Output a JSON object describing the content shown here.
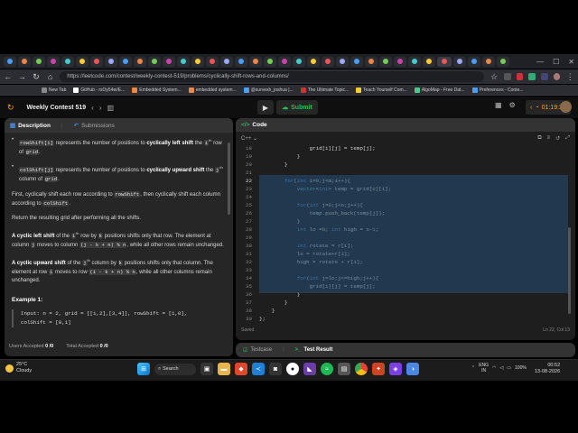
{
  "browser": {
    "url": "https://leetcode.com/contest/weekly-contest-519/problems/cyclically-shift-rows-and-columns/",
    "bookmarks": [
      "New Tab",
      "GitHub - rsOy54ei/E...",
      "Embedded System...",
      "embedded system...",
      "@survesh_joshua |...",
      "The Ultimate Topic...",
      "Teach Yourself Com...",
      "AlgoMap - Free Dat...",
      "Preferences - Conte..."
    ],
    "tab_letters": [
      "D",
      "N",
      "F",
      "A",
      "F",
      "D",
      "C",
      "E",
      "F",
      "X",
      "F",
      "C",
      "F",
      "F",
      "B",
      "S",
      "D",
      "C",
      "C",
      "C",
      "A",
      "A",
      "T",
      "F",
      "F",
      "F",
      "F",
      "F",
      "M",
      "F",
      "E",
      "C",
      "F",
      "F",
      "V"
    ]
  },
  "header": {
    "contest_title": "Weekly Contest 519",
    "submit_label": "Submit",
    "timer": "01:19:29"
  },
  "description": {
    "tabs": {
      "description": "Description",
      "submissions": "Submissions"
    },
    "bullet1": {
      "code": "rowShift[i]",
      "t1": " represents the number of positions to ",
      "bold": "cyclically left shift",
      "t2": " the ",
      "ith": "i",
      "sup": "th",
      "t3": " row of ",
      "code2": "grid",
      "t4": "."
    },
    "bullet2": {
      "code": "colShift[j]",
      "t1": " represents the number of positions to ",
      "bold": "cyclically upward shift",
      "t2": " the ",
      "jth": "j",
      "sup": "th",
      "t3": " column of ",
      "code2": "grid",
      "t4": "."
    },
    "para1": {
      "t1": "First, cyclically shift each row according to ",
      "c1": "rowShift",
      "t2": ", then cyclically shift each column according to ",
      "c2": "colShift",
      "t3": "."
    },
    "para2": "Return the resulting grid after performing all the shifts.",
    "para3": {
      "b": "A cyclic left shift",
      "t1": " of the ",
      "ith": "i",
      "sup": "th",
      "t2": " row by ",
      "k": "k",
      "t3": " positions shifts only that row. The element at column ",
      "j": "j",
      "t4": " moves to column ",
      "c": "(j - k + n) % n",
      "t5": ", while all other rows remain unchanged."
    },
    "para4": {
      "b": "A cyclic upward shift",
      "t1": " of the ",
      "jth": "j",
      "sup": "th",
      "t2": " column by ",
      "k": "k",
      "t3": " positions shifts only that column. The element at row ",
      "i": "i",
      "t4": " moves to row ",
      "c": "(i - k + n) % n",
      "t5": ", while all other columns remain unchanged."
    },
    "example_title": "Example 1:",
    "example_line1": "Input: n = 2, grid = [[1,2],[3,4]], rowShift = [1,0],",
    "example_line2": "colShift = [0,1]",
    "footer": {
      "users_accepted": "Users Accepted",
      "users_val": "0 /0",
      "total_accepted": "Total Accepted",
      "total_val": "0 /0"
    }
  },
  "code": {
    "title": "Code",
    "language": "C++",
    "status_left": "Saved",
    "status_right": "Ln 22, Col 13",
    "lines": [
      {
        "n": "18",
        "t": "                grid[i][j] = temp[j];"
      },
      {
        "n": "19",
        "t": "            }"
      },
      {
        "n": "20",
        "t": "        }"
      },
      {
        "n": "21",
        "t": ""
      },
      {
        "n": "22",
        "t": "        for(int i=0;j<m;i++){"
      },
      {
        "n": "23",
        "t": "            vector<int> temp = grid[0][i];"
      },
      {
        "n": "24",
        "t": ""
      },
      {
        "n": "25",
        "t": "            for(int j=0;j<n;j++){"
      },
      {
        "n": "26",
        "t": "                temp.push_back(temp[j]);"
      },
      {
        "n": "27",
        "t": "            }"
      },
      {
        "n": "28",
        "t": "            int lo =0; int high = n-1;"
      },
      {
        "n": "29",
        "t": ""
      },
      {
        "n": "30",
        "t": "            int rotate = r[i];"
      },
      {
        "n": "31",
        "t": "            lo = rotate+r[i];"
      },
      {
        "n": "32",
        "t": "            high = rotate + r[i];"
      },
      {
        "n": "33",
        "t": ""
      },
      {
        "n": "34",
        "t": "            for(int j=lo;j<=high;j++){"
      },
      {
        "n": "35",
        "t": "                grid[i][j] = temp[j];"
      },
      {
        "n": "36",
        "t": "            }"
      },
      {
        "n": "37",
        "t": "        }"
      },
      {
        "n": "38",
        "t": "    }"
      },
      {
        "n": "39",
        "t": "};"
      }
    ]
  },
  "bottom_tabs": {
    "testcase": "Testcase",
    "test_result": "Test Result"
  },
  "taskbar": {
    "weather_temp": "25°C",
    "weather_desc": "Cloudy",
    "search": "Search",
    "lang1": "ENG",
    "lang2": "IN",
    "battery": "100%",
    "time": "00:52",
    "date": "13-08-2026"
  }
}
